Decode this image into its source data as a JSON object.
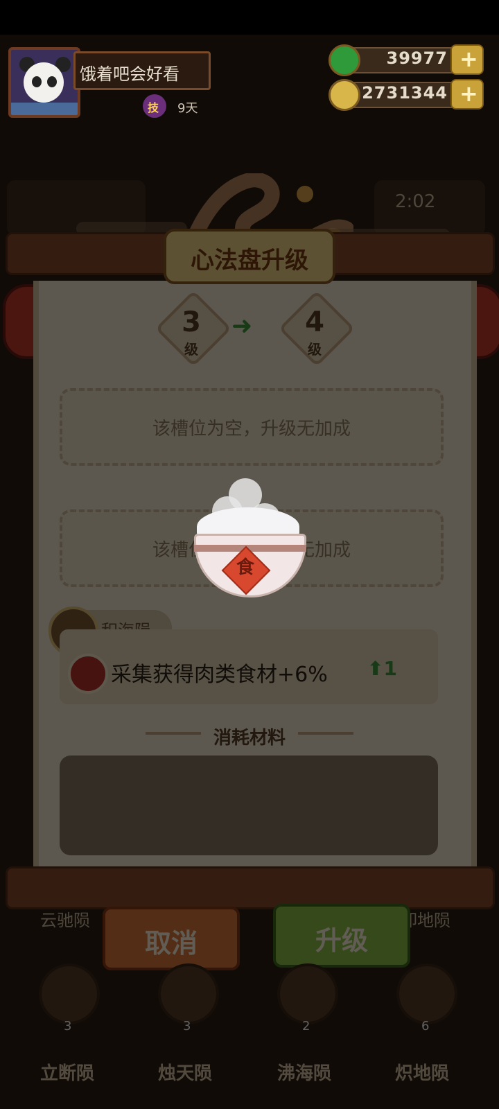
{
  "header": {
    "player_name": "饿着吧会好看",
    "skill_badge": "技",
    "days": "9天",
    "currency_jade": "39977",
    "currency_coins": "2731344",
    "plus": "+"
  },
  "background": {
    "right_value": "2:02"
  },
  "dialog": {
    "title": "心法盘升级",
    "from_level": "3",
    "to_level": "4",
    "level_unit": "级",
    "slot1": "该槽位为空，升级无加成",
    "slot2": "该槽位为空，升级无加成",
    "tag_name": "积海陨",
    "stat_text": "采集获得肉类食材+6%",
    "stat_up": "1",
    "materials_title": "消耗材料",
    "cancel": "取消",
    "upgrade": "升级"
  },
  "loading": {
    "bowl_char": "食"
  },
  "bottom": {
    "behind_left": "云驰陨",
    "behind_right": "卸地陨",
    "items": [
      {
        "label": "立断陨",
        "count": "3"
      },
      {
        "label": "烛天陨",
        "count": "3"
      },
      {
        "label": "沸海陨",
        "count": "2"
      },
      {
        "label": "炽地陨",
        "count": "6"
      }
    ]
  },
  "colors": {
    "upgrade_green": "#8fbf49",
    "cancel_orange": "#d9773a",
    "title_gold": "#f3d58a"
  }
}
